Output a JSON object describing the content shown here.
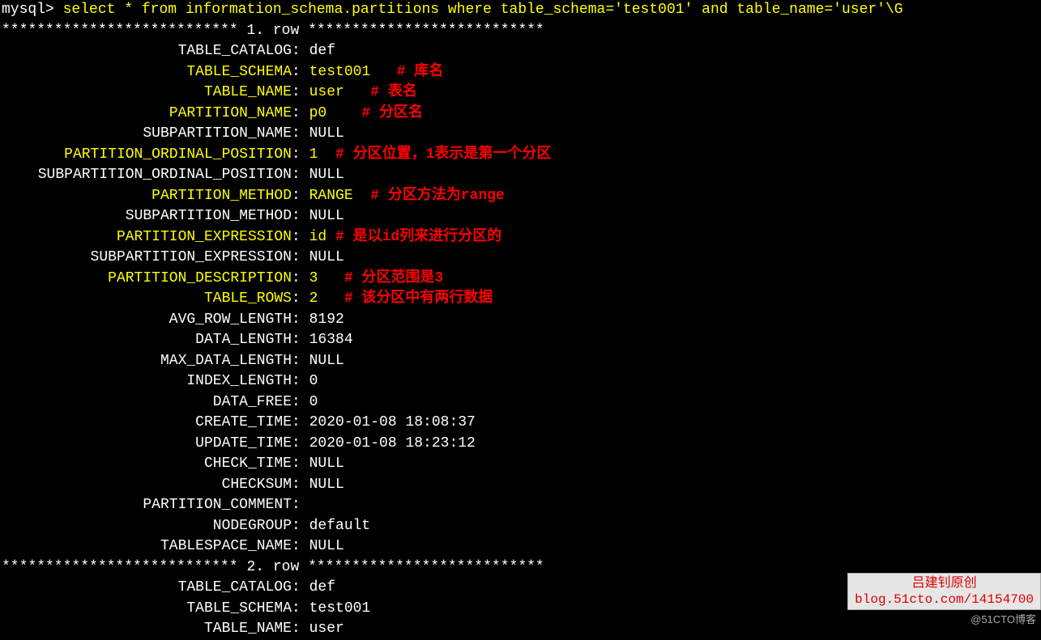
{
  "prompt": "mysql> ",
  "command": "select * from information_schema.partitions where table_schema='test001' and table_name='user'\\G",
  "row1_header_left": "*************************** ",
  "row1_header_mid": "1. row ",
  "row1_header_right": "***************************",
  "rows": [
    {
      "label": "TABLE_CATALOG",
      "sep": ": ",
      "value": "def",
      "hl": false,
      "note": ""
    },
    {
      "label": "TABLE_SCHEMA",
      "sep": ": ",
      "value": "test001   ",
      "hl": true,
      "note": "# 库名"
    },
    {
      "label": "TABLE_NAME",
      "sep": ": ",
      "value": "user   ",
      "hl": true,
      "note": "# 表名"
    },
    {
      "label": "PARTITION_NAME",
      "sep": ": ",
      "value": "p0    ",
      "hl": true,
      "note": "# 分区名"
    },
    {
      "label": "SUBPARTITION_NAME",
      "sep": ": ",
      "value": "NULL",
      "hl": false,
      "note": ""
    },
    {
      "label": "PARTITION_ORDINAL_POSITION",
      "sep": ": ",
      "value": "1  ",
      "hl": true,
      "note": "# 分区位置，1表示是第一个分区"
    },
    {
      "label": "SUBPARTITION_ORDINAL_POSITION",
      "sep": ": ",
      "value": "NULL",
      "hl": false,
      "note": ""
    },
    {
      "label": "PARTITION_METHOD",
      "sep": ": ",
      "value": "RANGE  ",
      "hl": true,
      "note": "# 分区方法为range"
    },
    {
      "label": "SUBPARTITION_METHOD",
      "sep": ": ",
      "value": "NULL",
      "hl": false,
      "note": ""
    },
    {
      "label": "PARTITION_EXPRESSION",
      "sep": ": ",
      "value": "id ",
      "hl": true,
      "note": "# 是以id列来进行分区的"
    },
    {
      "label": "SUBPARTITION_EXPRESSION",
      "sep": ": ",
      "value": "NULL",
      "hl": false,
      "note": ""
    },
    {
      "label": "PARTITION_DESCRIPTION",
      "sep": ": ",
      "value": "3   ",
      "hl": true,
      "note": "# 分区范围是3"
    },
    {
      "label": "TABLE_ROWS",
      "sep": ": ",
      "value": "2   ",
      "hl": true,
      "note": "# 该分区中有两行数据"
    },
    {
      "label": "AVG_ROW_LENGTH",
      "sep": ": ",
      "value": "8192",
      "hl": false,
      "note": ""
    },
    {
      "label": "DATA_LENGTH",
      "sep": ": ",
      "value": "16384",
      "hl": false,
      "note": ""
    },
    {
      "label": "MAX_DATA_LENGTH",
      "sep": ": ",
      "value": "NULL",
      "hl": false,
      "note": ""
    },
    {
      "label": "INDEX_LENGTH",
      "sep": ": ",
      "value": "0",
      "hl": false,
      "note": ""
    },
    {
      "label": "DATA_FREE",
      "sep": ": ",
      "value": "0",
      "hl": false,
      "note": ""
    },
    {
      "label": "CREATE_TIME",
      "sep": ": ",
      "value": "2020-01-08 18:08:37",
      "hl": false,
      "note": ""
    },
    {
      "label": "UPDATE_TIME",
      "sep": ": ",
      "value": "2020-01-08 18:23:12",
      "hl": false,
      "note": ""
    },
    {
      "label": "CHECK_TIME",
      "sep": ": ",
      "value": "NULL",
      "hl": false,
      "note": ""
    },
    {
      "label": "CHECKSUM",
      "sep": ": ",
      "value": "NULL",
      "hl": false,
      "note": ""
    },
    {
      "label": "PARTITION_COMMENT",
      "sep": ": ",
      "value": "",
      "hl": false,
      "note": ""
    },
    {
      "label": "NODEGROUP",
      "sep": ": ",
      "value": "default",
      "hl": false,
      "note": ""
    },
    {
      "label": "TABLESPACE_NAME",
      "sep": ": ",
      "value": "NULL",
      "hl": false,
      "note": ""
    }
  ],
  "row2_header_left": "*************************** ",
  "row2_header_mid": "2. row ",
  "row2_header_right": "***************************",
  "rows2": [
    {
      "label": "TABLE_CATALOG",
      "sep": ": ",
      "value": "def",
      "hl": false,
      "note": ""
    },
    {
      "label": "TABLE_SCHEMA",
      "sep": ": ",
      "value": "test001",
      "hl": false,
      "note": ""
    },
    {
      "label": "TABLE_NAME",
      "sep": ": ",
      "value": "user",
      "hl": false,
      "note": ""
    }
  ],
  "watermark": {
    "line1": "吕建钊原创",
    "line2": "blog.51cto.com/14154700",
    "small": "@51CTO博客"
  }
}
